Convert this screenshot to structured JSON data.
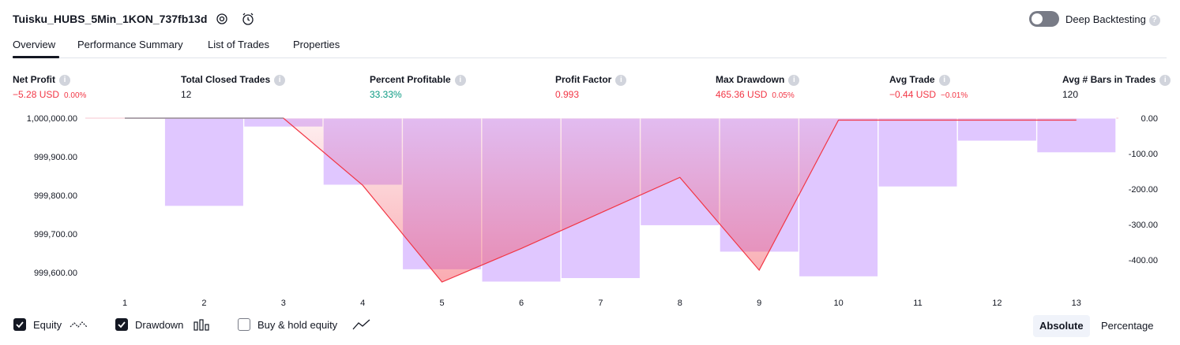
{
  "header": {
    "title": "Tuisku_HUBS_5Min_1KON_737fb13d",
    "deep_backtesting_label": "Deep Backtesting",
    "deep_backtesting_on": false
  },
  "tabs": [
    {
      "label": "Overview",
      "active": true
    },
    {
      "label": "Performance Summary",
      "active": false
    },
    {
      "label": "List of Trades",
      "active": false
    },
    {
      "label": "Properties",
      "active": false
    }
  ],
  "metrics": [
    {
      "label": "Net Profit",
      "value": "−5.28 USD",
      "sub": "0.00%",
      "color": "#f23645"
    },
    {
      "label": "Total Closed Trades",
      "value": "12",
      "sub": "",
      "color": "#131722"
    },
    {
      "label": "Percent Profitable",
      "value": "33.33%",
      "sub": "",
      "color": "#089981"
    },
    {
      "label": "Profit Factor",
      "value": "0.993",
      "sub": "",
      "color": "#f23645"
    },
    {
      "label": "Max Drawdown",
      "value": "465.36 USD",
      "sub": "0.05%",
      "color": "#f23645"
    },
    {
      "label": "Avg Trade",
      "value": "−0.44 USD",
      "sub": "−0.01%",
      "color": "#f23645"
    },
    {
      "label": "Avg # Bars in Trades",
      "value": "120",
      "sub": "",
      "color": "#131722"
    }
  ],
  "chart_data": {
    "type": "line+bar",
    "x": [
      1,
      2,
      3,
      4,
      5,
      6,
      7,
      8,
      9,
      10,
      11,
      12,
      13
    ],
    "left_axis": {
      "ticks": [
        "1,000,000.00",
        "999,900.00",
        "999,800.00",
        "999,700.00",
        "999,600.00"
      ],
      "range": [
        999585,
        1000000
      ]
    },
    "right_axis": {
      "ticks": [
        "0.00",
        "-100.00",
        "-200.00",
        "-300.00",
        "-400.00"
      ],
      "range": [
        -465,
        0
      ]
    },
    "series": [
      {
        "name": "Equity",
        "axis": "left",
        "color": "#f23645",
        "values": [
          1000000,
          1000000,
          1000000,
          999830,
          999585,
          999670,
          999760,
          999850,
          999615,
          999995,
          999995,
          999995,
          999995
        ]
      },
      {
        "name": "Drawdown",
        "axis": "right",
        "type": "bar",
        "color": "#e0c7ff",
        "values": [
          0,
          -250,
          -25,
          -190,
          -430,
          -465,
          -455,
          -305,
          -380,
          -450,
          -195,
          -65,
          -98
        ]
      }
    ]
  },
  "footer": {
    "equity_label": "Equity",
    "drawdown_label": "Drawdown",
    "buyhold_label": "Buy & hold equity",
    "equity_checked": true,
    "drawdown_checked": true,
    "buyhold_checked": false,
    "absolute_label": "Absolute",
    "percentage_label": "Percentage"
  }
}
